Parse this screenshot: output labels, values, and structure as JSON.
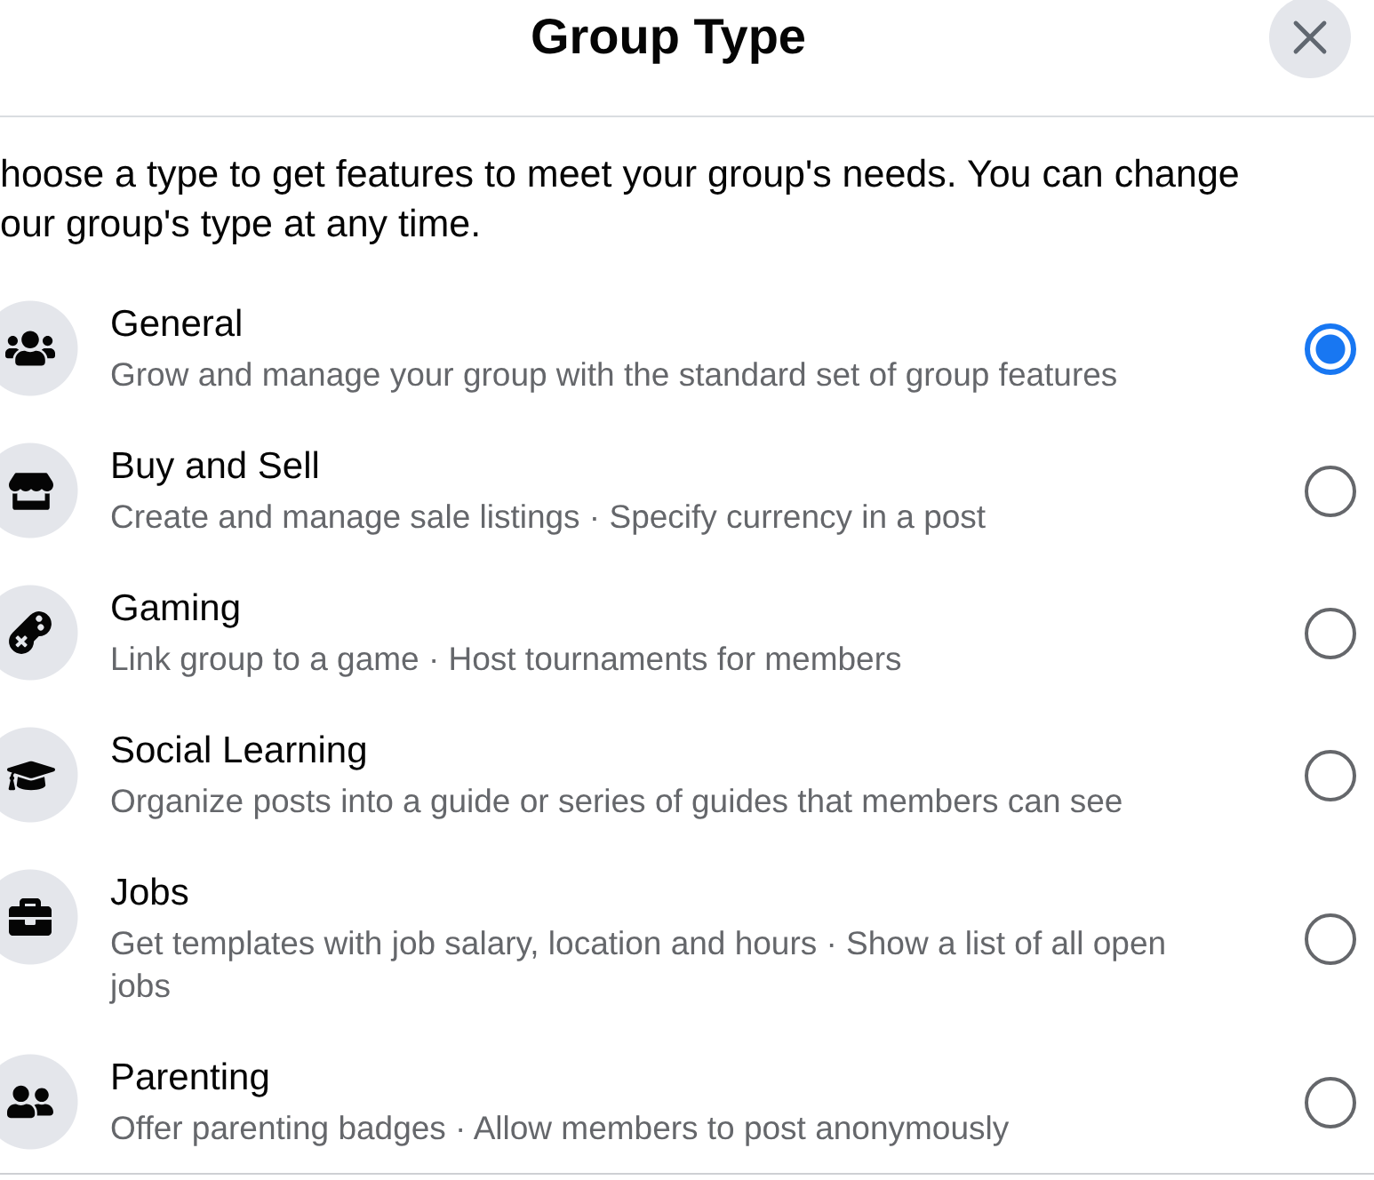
{
  "dialog": {
    "title": "Group Type"
  },
  "description": "hoose a type to get features to meet your group's needs. You can change our group's type at any time.",
  "options": [
    {
      "title": "General",
      "description": "Grow and manage your group with the standard set of group features",
      "selected": true
    },
    {
      "title": "Buy and Sell",
      "description": "Create and manage sale listings · Specify currency in a post",
      "selected": false
    },
    {
      "title": "Gaming",
      "description": "Link group to a game · Host tournaments for members",
      "selected": false
    },
    {
      "title": "Social Learning",
      "description": "Organize posts into a guide or series of guides that members can see",
      "selected": false
    },
    {
      "title": "Jobs",
      "description": "Get templates with job salary, location and hours · Show a list of all open jobs",
      "selected": false
    },
    {
      "title": "Parenting",
      "description": "Offer parenting badges · Allow members to post anonymously",
      "selected": false
    }
  ]
}
